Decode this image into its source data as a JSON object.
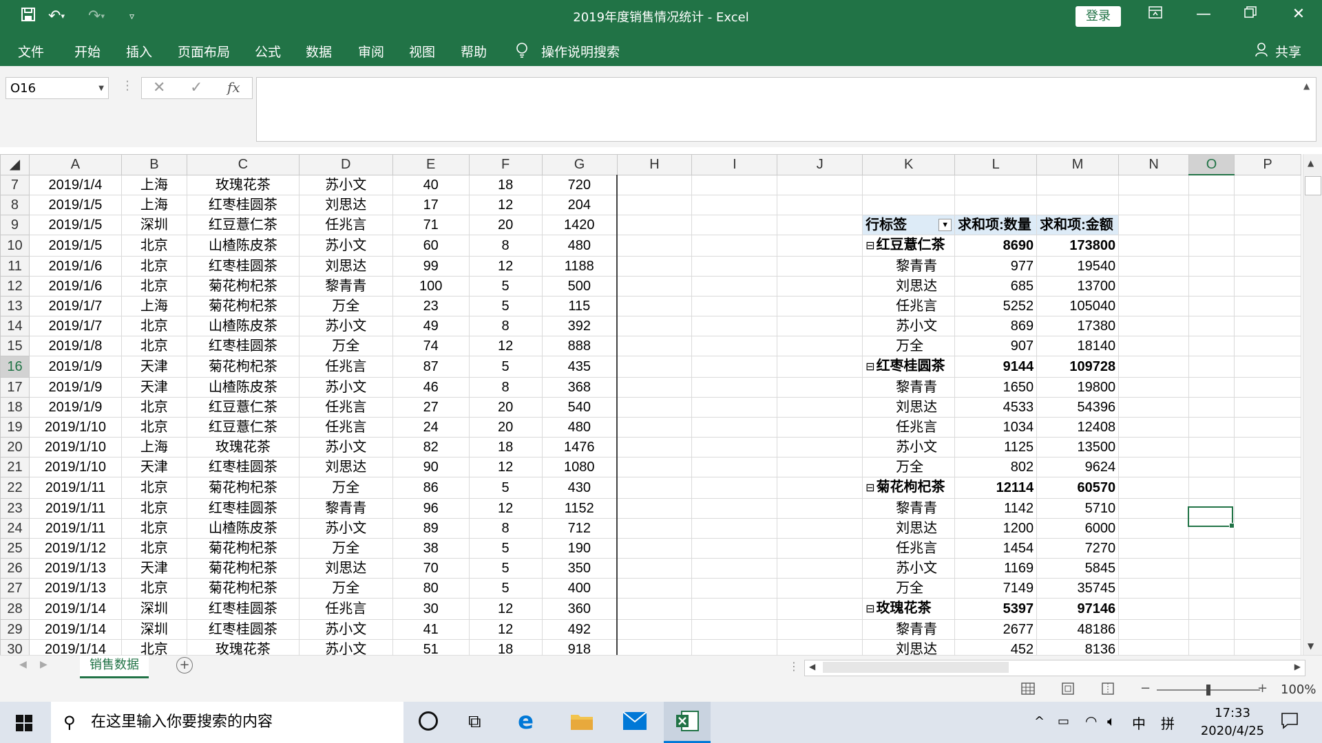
{
  "titlebar": {
    "title": "2019年度销售情况统计 - Excel",
    "login": "登录",
    "icons": [
      "save-icon",
      "undo-icon",
      "redo-icon",
      "customize-icon",
      "ribbon-display-icon",
      "minimize-icon",
      "restore-icon",
      "close-icon"
    ]
  },
  "menu": {
    "items": [
      "文件",
      "开始",
      "插入",
      "页面布局",
      "公式",
      "数据",
      "审阅",
      "视图",
      "帮助",
      "操作说明搜索"
    ],
    "share": "共享"
  },
  "formula": {
    "namebox": "O16",
    "fx": "fx",
    "value": ""
  },
  "columns": [
    "A",
    "B",
    "C",
    "D",
    "E",
    "F",
    "G",
    "H",
    "I",
    "J",
    "K",
    "L",
    "M",
    "N",
    "O",
    "P"
  ],
  "data_rows": [
    {
      "n": "7",
      "a": "2019/1/4",
      "b": "上海",
      "c": "玫瑰花茶",
      "d": "苏小文",
      "e": "40",
      "f": "18",
      "g": "720"
    },
    {
      "n": "8",
      "a": "2019/1/5",
      "b": "上海",
      "c": "红枣桂圆茶",
      "d": "刘思达",
      "e": "17",
      "f": "12",
      "g": "204"
    },
    {
      "n": "9",
      "a": "2019/1/5",
      "b": "深圳",
      "c": "红豆薏仁茶",
      "d": "任兆言",
      "e": "71",
      "f": "20",
      "g": "1420"
    },
    {
      "n": "10",
      "a": "2019/1/5",
      "b": "北京",
      "c": "山楂陈皮茶",
      "d": "苏小文",
      "e": "60",
      "f": "8",
      "g": "480"
    },
    {
      "n": "11",
      "a": "2019/1/6",
      "b": "北京",
      "c": "红枣桂圆茶",
      "d": "刘思达",
      "e": "99",
      "f": "12",
      "g": "1188"
    },
    {
      "n": "12",
      "a": "2019/1/6",
      "b": "北京",
      "c": "菊花枸杞茶",
      "d": "黎青青",
      "e": "100",
      "f": "5",
      "g": "500"
    },
    {
      "n": "13",
      "a": "2019/1/7",
      "b": "上海",
      "c": "菊花枸杞茶",
      "d": "万全",
      "e": "23",
      "f": "5",
      "g": "115"
    },
    {
      "n": "14",
      "a": "2019/1/7",
      "b": "北京",
      "c": "山楂陈皮茶",
      "d": "苏小文",
      "e": "49",
      "f": "8",
      "g": "392"
    },
    {
      "n": "15",
      "a": "2019/1/8",
      "b": "北京",
      "c": "红枣桂圆茶",
      "d": "万全",
      "e": "74",
      "f": "12",
      "g": "888"
    },
    {
      "n": "16",
      "a": "2019/1/9",
      "b": "天津",
      "c": "菊花枸杞茶",
      "d": "任兆言",
      "e": "87",
      "f": "5",
      "g": "435"
    },
    {
      "n": "17",
      "a": "2019/1/9",
      "b": "天津",
      "c": "山楂陈皮茶",
      "d": "苏小文",
      "e": "46",
      "f": "8",
      "g": "368"
    },
    {
      "n": "18",
      "a": "2019/1/9",
      "b": "北京",
      "c": "红豆薏仁茶",
      "d": "任兆言",
      "e": "27",
      "f": "20",
      "g": "540"
    },
    {
      "n": "19",
      "a": "2019/1/10",
      "b": "北京",
      "c": "红豆薏仁茶",
      "d": "任兆言",
      "e": "24",
      "f": "20",
      "g": "480"
    },
    {
      "n": "20",
      "a": "2019/1/10",
      "b": "上海",
      "c": "玫瑰花茶",
      "d": "苏小文",
      "e": "82",
      "f": "18",
      "g": "1476"
    },
    {
      "n": "21",
      "a": "2019/1/10",
      "b": "天津",
      "c": "红枣桂圆茶",
      "d": "刘思达",
      "e": "90",
      "f": "12",
      "g": "1080"
    },
    {
      "n": "22",
      "a": "2019/1/11",
      "b": "北京",
      "c": "菊花枸杞茶",
      "d": "万全",
      "e": "86",
      "f": "5",
      "g": "430"
    },
    {
      "n": "23",
      "a": "2019/1/11",
      "b": "北京",
      "c": "红枣桂圆茶",
      "d": "黎青青",
      "e": "96",
      "f": "12",
      "g": "1152"
    },
    {
      "n": "24",
      "a": "2019/1/11",
      "b": "北京",
      "c": "山楂陈皮茶",
      "d": "苏小文",
      "e": "89",
      "f": "8",
      "g": "712"
    },
    {
      "n": "25",
      "a": "2019/1/12",
      "b": "北京",
      "c": "菊花枸杞茶",
      "d": "万全",
      "e": "38",
      "f": "5",
      "g": "190"
    },
    {
      "n": "26",
      "a": "2019/1/13",
      "b": "天津",
      "c": "菊花枸杞茶",
      "d": "刘思达",
      "e": "70",
      "f": "5",
      "g": "350"
    },
    {
      "n": "27",
      "a": "2019/1/13",
      "b": "北京",
      "c": "菊花枸杞茶",
      "d": "万全",
      "e": "80",
      "f": "5",
      "g": "400"
    },
    {
      "n": "28",
      "a": "2019/1/14",
      "b": "深圳",
      "c": "红枣桂圆茶",
      "d": "任兆言",
      "e": "30",
      "f": "12",
      "g": "360"
    },
    {
      "n": "29",
      "a": "2019/1/14",
      "b": "深圳",
      "c": "红枣桂圆茶",
      "d": "苏小文",
      "e": "41",
      "f": "12",
      "g": "492"
    },
    {
      "n": "30",
      "a": "2019/1/14",
      "b": "北京",
      "c": "玫瑰花茶",
      "d": "苏小文",
      "e": "51",
      "f": "18",
      "g": "918"
    }
  ],
  "pivot": {
    "headers": [
      "行标签",
      "求和项:数量",
      "求和项:金额"
    ],
    "rows": [
      {
        "label": "红豆薏仁茶",
        "qty": "8690",
        "amt": "173800",
        "group": true
      },
      {
        "label": "黎青青",
        "qty": "977",
        "amt": "19540",
        "group": false
      },
      {
        "label": "刘思达",
        "qty": "685",
        "amt": "13700",
        "group": false
      },
      {
        "label": "任兆言",
        "qty": "5252",
        "amt": "105040",
        "group": false
      },
      {
        "label": "苏小文",
        "qty": "869",
        "amt": "17380",
        "group": false
      },
      {
        "label": "万全",
        "qty": "907",
        "amt": "18140",
        "group": false
      },
      {
        "label": "红枣桂圆茶",
        "qty": "9144",
        "amt": "109728",
        "group": true
      },
      {
        "label": "黎青青",
        "qty": "1650",
        "amt": "19800",
        "group": false
      },
      {
        "label": "刘思达",
        "qty": "4533",
        "amt": "54396",
        "group": false
      },
      {
        "label": "任兆言",
        "qty": "1034",
        "amt": "12408",
        "group": false
      },
      {
        "label": "苏小文",
        "qty": "1125",
        "amt": "13500",
        "group": false
      },
      {
        "label": "万全",
        "qty": "802",
        "amt": "9624",
        "group": false
      },
      {
        "label": "菊花枸杞茶",
        "qty": "12114",
        "amt": "60570",
        "group": true
      },
      {
        "label": "黎青青",
        "qty": "1142",
        "amt": "5710",
        "group": false
      },
      {
        "label": "刘思达",
        "qty": "1200",
        "amt": "6000",
        "group": false
      },
      {
        "label": "任兆言",
        "qty": "1454",
        "amt": "7270",
        "group": false
      },
      {
        "label": "苏小文",
        "qty": "1169",
        "amt": "5845",
        "group": false
      },
      {
        "label": "万全",
        "qty": "7149",
        "amt": "35745",
        "group": false
      },
      {
        "label": "玫瑰花茶",
        "qty": "5397",
        "amt": "97146",
        "group": true
      },
      {
        "label": "黎青青",
        "qty": "2677",
        "amt": "48186",
        "group": false
      },
      {
        "label": "刘思达",
        "qty": "452",
        "amt": "8136",
        "group": false
      }
    ]
  },
  "sheet_tab": "销售数据",
  "status": {
    "zoom": "100%"
  },
  "taskbar": {
    "search_placeholder": "在这里输入你要搜索的内容",
    "ime1": "中",
    "ime2": "拼",
    "time": "17:33",
    "date": "2020/4/25"
  }
}
